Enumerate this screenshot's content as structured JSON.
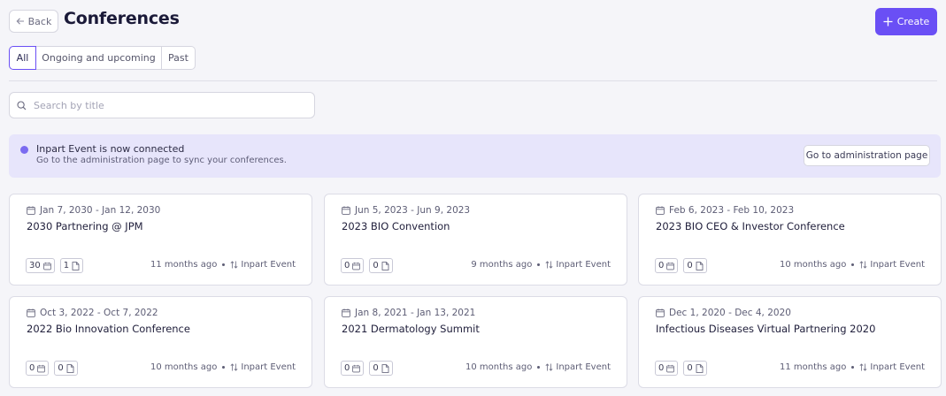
{
  "header": {
    "back_label": "Back",
    "title": "Conferences",
    "create_label": "Create"
  },
  "tabs": [
    {
      "label": "All",
      "active": true
    },
    {
      "label": "Ongoing and upcoming",
      "active": false
    },
    {
      "label": "Past",
      "active": false
    }
  ],
  "search": {
    "placeholder": "Search by title",
    "value": ""
  },
  "banner": {
    "title": "Inpart Event is now connected",
    "subtitle": "Go to the administration page to sync your conferences.",
    "button_label": "Go to administration page"
  },
  "conferences": [
    {
      "dates": "Jan 7, 2030 - Jan 12, 2030",
      "title": "2030 Partnering @ JPM",
      "count_a": "30",
      "count_b": "1",
      "updated": "11 months ago",
      "source": "Inpart Event"
    },
    {
      "dates": "Jun 5, 2023 - Jun 9, 2023",
      "title": "2023 BIO Convention",
      "count_a": "0",
      "count_b": "0",
      "updated": "9 months ago",
      "source": "Inpart Event"
    },
    {
      "dates": "Feb 6, 2023 - Feb 10, 2023",
      "title": "2023 BIO CEO & Investor Conference",
      "count_a": "0",
      "count_b": "0",
      "updated": "10 months ago",
      "source": "Inpart Event"
    },
    {
      "dates": "Oct 3, 2022 - Oct 7, 2022",
      "title": "2022 Bio Innovation Conference",
      "count_a": "0",
      "count_b": "0",
      "updated": "10 months ago",
      "source": "Inpart Event"
    },
    {
      "dates": "Jan 8, 2021 - Jan 13, 2021",
      "title": "2021 Dermatology Summit",
      "count_a": "0",
      "count_b": "0",
      "updated": "10 months ago",
      "source": "Inpart Event"
    },
    {
      "dates": "Dec 1, 2020 - Dec 4, 2020",
      "title": "Infectious Diseases Virtual Partnering 2020",
      "count_a": "0",
      "count_b": "0",
      "updated": "11 months ago",
      "source": "Inpart Event"
    }
  ],
  "colors": {
    "accent": "#6a4ff5",
    "banner_bg": "#e7e5fb",
    "page_bg": "#f5f5f9"
  }
}
